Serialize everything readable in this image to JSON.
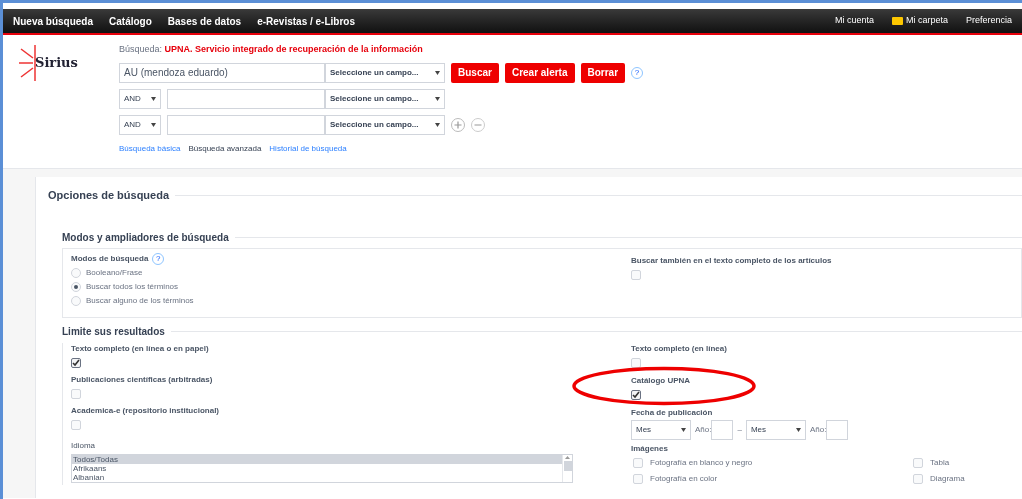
{
  "nav": {
    "left": [
      "Nueva búsqueda",
      "Catálogo",
      "Bases de datos",
      "e-Revistas / e-Libros"
    ],
    "right": [
      {
        "label": "Mi cuenta",
        "kind": "link"
      },
      {
        "label": "Mi carpeta",
        "kind": "folder"
      },
      {
        "label": "Preferencia",
        "kind": "link"
      }
    ]
  },
  "logo": "Sirius",
  "help_mark": "?",
  "search": {
    "label": "Búsqueda:",
    "source": "UPNA. Servicio integrado de recuperación de la información",
    "rows": [
      {
        "operator": null,
        "value": "AU (mendoza eduardo)",
        "field": "Seleccione un campo..."
      },
      {
        "operator": "AND",
        "value": null,
        "field": "Seleccione un campo..."
      },
      {
        "operator": "AND",
        "value": null,
        "field": "Seleccione un campo..."
      }
    ],
    "buttons": [
      "Buscar",
      "Crear alerta",
      "Borrar"
    ],
    "links": [
      {
        "label": "Búsqueda básica",
        "selected": false
      },
      {
        "label": "Búsqueda avanzada",
        "selected": true
      },
      {
        "label": "Historial de búsqueda",
        "selected": false
      }
    ]
  },
  "options": {
    "title": "Opciones de búsqueda",
    "modes": {
      "title": "Modos y ampliadores de búsqueda",
      "label": "Modos de búsqueda",
      "radios": [
        {
          "label": "Booleano/Frase",
          "selected": false
        },
        {
          "label": "Buscar todos los términos",
          "selected": true
        },
        {
          "label": "Buscar alguno de los términos",
          "selected": false
        }
      ],
      "fulltext": {
        "label": "Buscar también en el texto completo de los artículos",
        "checked": false
      }
    },
    "limits": {
      "title": "Limite sus resultados",
      "left": [
        {
          "label": "Texto completo (en línea o en papel)",
          "checked": true
        },
        {
          "label": "Publicaciones científicas (arbitradas)",
          "checked": false
        },
        {
          "label": "Academica-e (repositorio institucional)",
          "checked": false
        }
      ],
      "language": {
        "label": "Idioma",
        "options": [
          {
            "label": "Todos/Todas",
            "selected": true
          },
          {
            "label": "Afrikaans",
            "selected": false
          },
          {
            "label": "Albanian",
            "selected": false
          }
        ]
      },
      "right": [
        {
          "label": "Texto completo (en línea)",
          "checked": false,
          "highlighted": false
        },
        {
          "label": "Catálogo UPNA",
          "checked": true,
          "highlighted": true
        }
      ],
      "date": {
        "label": "Fecha de publicación",
        "from_month": "Mes",
        "from_year_label": "Año:",
        "separator": "–",
        "to_month": "Mes",
        "to_year_label": "Año:"
      },
      "images": {
        "label": "Imágenes",
        "items": [
          {
            "label": "Fotografía en blanco y negro",
            "checked": false
          },
          {
            "label": "Tabla",
            "checked": false
          },
          {
            "label": "Fotografía en color",
            "checked": false
          },
          {
            "label": "Diagrama",
            "checked": false
          }
        ]
      }
    }
  }
}
